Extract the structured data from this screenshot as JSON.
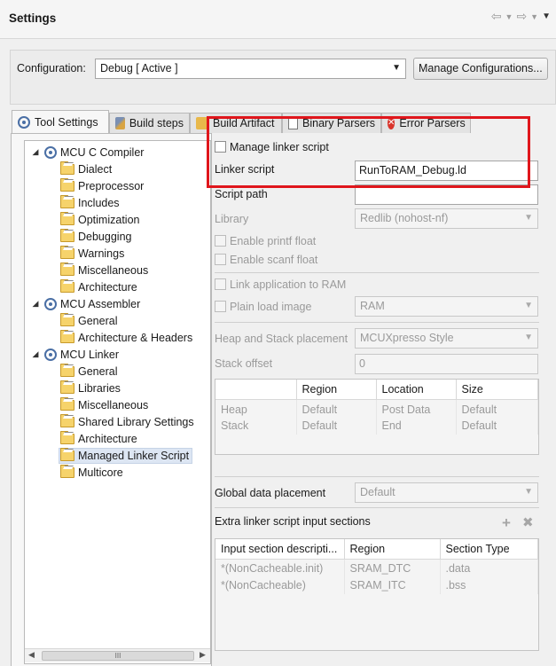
{
  "window": {
    "title": "Settings"
  },
  "config": {
    "label": "Configuration:",
    "selected": "Debug  [ Active ]",
    "manage_button": "Manage Configurations..."
  },
  "tabs": [
    {
      "label": "Tool Settings",
      "icon": "tool-settings-icon"
    },
    {
      "label": "Build steps",
      "icon": "build-steps-icon"
    },
    {
      "label": "Build Artifact",
      "icon": "build-artifact-icon"
    },
    {
      "label": "Binary Parsers",
      "icon": "binary-parsers-icon"
    },
    {
      "label": "Error Parsers",
      "icon": "error-parsers-icon"
    }
  ],
  "tree": {
    "c_compiler": {
      "label": "MCU C Compiler",
      "children": [
        "Dialect",
        "Preprocessor",
        "Includes",
        "Optimization",
        "Debugging",
        "Warnings",
        "Miscellaneous",
        "Architecture"
      ]
    },
    "assembler": {
      "label": "MCU Assembler",
      "children": [
        "General",
        "Architecture & Headers"
      ]
    },
    "linker": {
      "label": "MCU Linker",
      "children": [
        "General",
        "Libraries",
        "Miscellaneous",
        "Shared Library Settings",
        "Architecture",
        "Managed Linker Script",
        "Multicore"
      ]
    },
    "selected": "Managed Linker Script"
  },
  "form": {
    "manage_linker_script": "Manage linker script",
    "linker_script_label": "Linker script",
    "linker_script_value": "RunToRAM_Debug.ld",
    "script_path_label": "Script path",
    "library_label": "Library",
    "library_value": "Redlib (nohost-nf)",
    "enable_printf_float": "Enable printf float",
    "enable_scanf_float": "Enable scanf float",
    "link_to_ram": "Link application to RAM",
    "plain_load_image": "Plain load image",
    "plain_load_value": "RAM",
    "heap_stack_label": "Heap and Stack placement",
    "heap_stack_value": "MCUXpresso Style",
    "stack_offset_label": "Stack offset",
    "stack_offset_value": "0",
    "heap_table": {
      "headers": [
        "",
        "Region",
        "Location",
        "Size"
      ],
      "rows": [
        [
          "Heap",
          "Default",
          "Post Data",
          "Default"
        ],
        [
          "Stack",
          "Default",
          "End",
          "Default"
        ]
      ]
    },
    "global_data_label": "Global data placement",
    "global_data_value": "Default",
    "extra_sections_label": "Extra linker script input sections",
    "sections_table": {
      "headers": [
        "Input section descripti...",
        "Region",
        "Section Type"
      ],
      "rows": [
        [
          "*(NonCacheable.init)",
          "SRAM_DTC",
          ".data"
        ],
        [
          "*(NonCacheable)",
          "SRAM_ITC",
          ".bss"
        ]
      ]
    }
  },
  "scroll": {
    "thumb": "III"
  }
}
